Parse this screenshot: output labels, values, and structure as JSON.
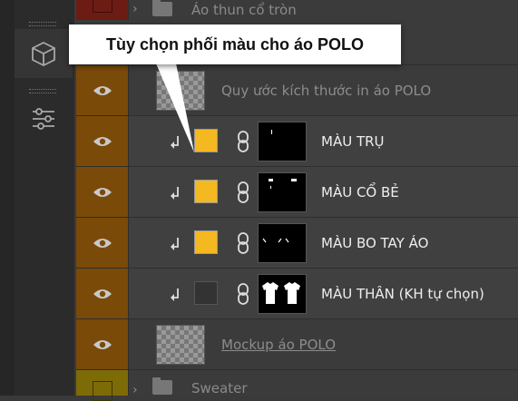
{
  "colors": {
    "visibility_bg": "#7a4a08",
    "accent_swatch": "#f4b820",
    "panel_bg": "#3b3b3b"
  },
  "callout": {
    "text": "Tùy chọn phối màu cho áo POLO"
  },
  "toolbar": {
    "icons": [
      "cube-icon",
      "sliders-icon"
    ]
  },
  "layers": [
    {
      "kind": "group",
      "name": "Áo thun cổ tròn",
      "icon": "folder-icon"
    },
    {
      "kind": "layer",
      "name": "Quy ước kích thước in áo POLO",
      "indent": 1
    },
    {
      "kind": "layer",
      "name": "MÀU TRỤ",
      "clipped": true,
      "swatch": "#f4b820",
      "linked": true
    },
    {
      "kind": "layer",
      "name": "MÀU CỔ BẺ",
      "clipped": true,
      "swatch": "#f4b820",
      "linked": true
    },
    {
      "kind": "layer",
      "name": "MÀU BO TAY ÁO",
      "clipped": true,
      "swatch": "#f4b820",
      "linked": true
    },
    {
      "kind": "layer",
      "name": "MÀU THÂN (KH tự chọn)",
      "clipped": true,
      "swatch": "#333333",
      "linked": true
    },
    {
      "kind": "layer",
      "name": "Mockup áo POLO",
      "indent": 1
    },
    {
      "kind": "group",
      "name": "Sweater",
      "icon": "folder-icon"
    }
  ]
}
